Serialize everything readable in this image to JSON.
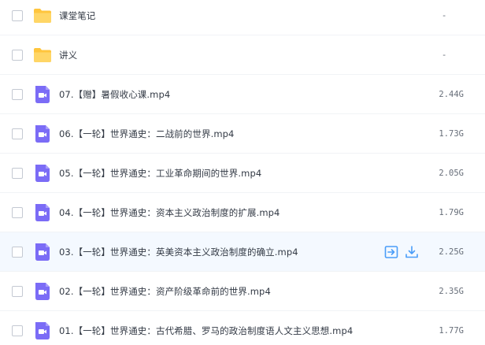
{
  "files": [
    {
      "name": "课堂笔记",
      "size": "-",
      "type": "folder"
    },
    {
      "name": "讲义",
      "size": "-",
      "type": "folder"
    },
    {
      "name": "07.【赠】暑假收心课.mp4",
      "size": "2.44G",
      "type": "video"
    },
    {
      "name": "06.【一轮】世界通史：二战前的世界.mp4",
      "size": "1.73G",
      "type": "video"
    },
    {
      "name": "05.【一轮】世界通史：工业革命期间的世界.mp4",
      "size": "2.05G",
      "type": "video"
    },
    {
      "name": "04.【一轮】世界通史：资本主义政治制度的扩展.mp4",
      "size": "1.79G",
      "type": "video"
    },
    {
      "name": "03.【一轮】世界通史：英美资本主义政治制度的确立.mp4",
      "size": "2.25G",
      "type": "video",
      "hovered": true
    },
    {
      "name": "02.【一轮】世界通史：资产阶级革命前的世界.mp4",
      "size": "2.35G",
      "type": "video"
    },
    {
      "name": "01.【一轮】世界通史：古代希腊、罗马的政治制度语人文主义思想.mp4",
      "size": "1.77G",
      "type": "video"
    }
  ],
  "icons": {
    "folder": "folder-icon",
    "video": "video-file-icon",
    "share": "share-icon",
    "download": "download-icon"
  },
  "colors": {
    "folder": "#ffc53d",
    "video": "#7b6cf6",
    "action": "#4a9df8",
    "hover_row": "#f4f9ff"
  }
}
